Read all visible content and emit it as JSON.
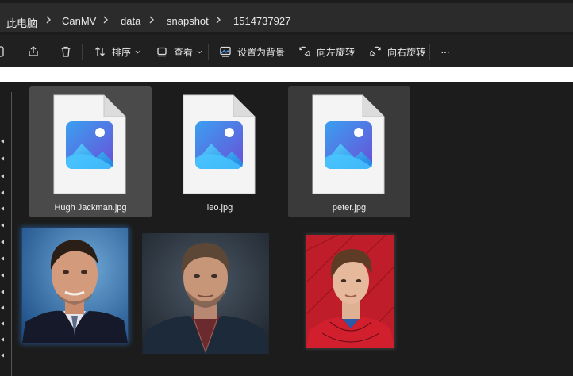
{
  "breadcrumb": {
    "items": [
      "此电脑",
      "CanMV",
      "data",
      "snapshot",
      "1514737927"
    ]
  },
  "toolbar": {
    "sort_label": "排序",
    "view_label": "查看",
    "set_bg_label": "设置为背景",
    "rotate_left_label": "向左旋转",
    "rotate_right_label": "向右旋转",
    "more_label": "···"
  },
  "files": [
    {
      "name": "Hugh Jackman.jpg",
      "state": "selected"
    },
    {
      "name": "leo.jpg",
      "state": "normal"
    },
    {
      "name": "peter.jpg",
      "state": "hover"
    }
  ],
  "colors": {
    "accent": "#2d7cd6",
    "selected_tile": "#4a4a4a",
    "hover_tile": "#3a3a3a"
  }
}
